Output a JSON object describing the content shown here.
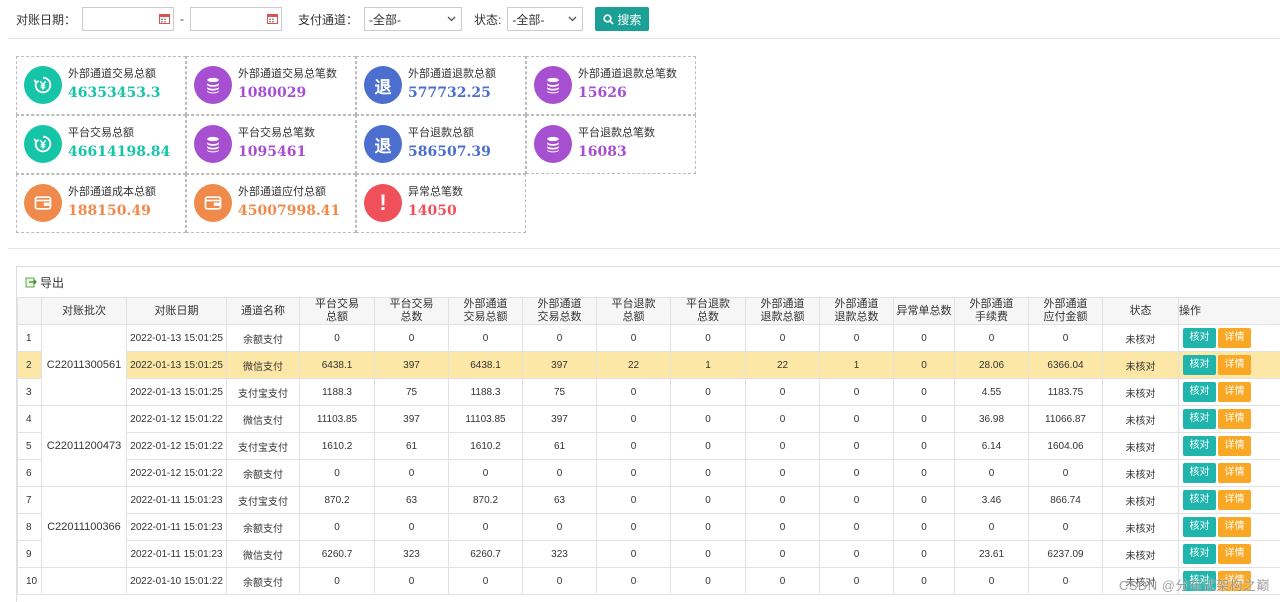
{
  "filters": {
    "date_label": "对账日期：",
    "date_sep": "-",
    "channel_label": "支付通道：",
    "channel_value": "-全部-",
    "status_label": "状态:",
    "status_value": "-全部-",
    "search_label": "搜索"
  },
  "colors": {
    "teal": "#16c4a8",
    "purple": "#a74fd1",
    "blue": "#4c6fcf",
    "orange": "#f08a4b",
    "red": "#f0505a",
    "search_button": "#1aa094",
    "row_highlight": "#fde7a6"
  },
  "stats": [
    {
      "label": "外部通道交易总额",
      "value": "46353453.3",
      "color": "#16c4a8",
      "icon": "refresh-yen-icon",
      "glyph": ""
    },
    {
      "label": "外部通道交易总笔数",
      "value": "1080029",
      "color": "#a74fd1",
      "icon": "coin-stack-icon",
      "glyph": ""
    },
    {
      "label": "外部通道退款总额",
      "value": "577732.25",
      "color": "#4c6fcf",
      "icon": "refund-icon",
      "glyph": "退"
    },
    {
      "label": "外部通道退款总笔数",
      "value": "15626",
      "color": "#a74fd1",
      "icon": "coin-stack-icon",
      "glyph": ""
    },
    {
      "label": "平台交易总额",
      "value": "46614198.84",
      "color": "#16c4a8",
      "icon": "refresh-yen-icon",
      "glyph": ""
    },
    {
      "label": "平台交易总笔数",
      "value": "1095461",
      "color": "#a74fd1",
      "icon": "coin-stack-icon",
      "glyph": ""
    },
    {
      "label": "平台退款总额",
      "value": "586507.39",
      "color": "#4c6fcf",
      "icon": "refund-icon",
      "glyph": "退"
    },
    {
      "label": "平台退款总笔数",
      "value": "16083",
      "color": "#a74fd1",
      "icon": "coin-stack-icon",
      "glyph": ""
    },
    {
      "label": "外部通道成本总额",
      "value": "188150.49",
      "color": "#f08a4b",
      "icon": "wallet-icon",
      "glyph": ""
    },
    {
      "label": "外部通道应付总额",
      "value": "45007998.41",
      "color": "#f08a4b",
      "icon": "wallet-icon",
      "glyph": ""
    },
    {
      "label": "异常总笔数",
      "value": "14050",
      "color": "#f0505a",
      "icon": "exclamation-icon",
      "glyph": "!"
    }
  ],
  "table": {
    "export_label": "导出",
    "columns": [
      "",
      "对账批次",
      "对账日期",
      "通道名称",
      "平台交易\n总额",
      "平台交易\n总数",
      "外部通道\n交易总额",
      "外部通道\n交易总数",
      "平台退款\n总额",
      "平台退款\n总数",
      "外部通道\n退款总额",
      "外部通道\n退款总数",
      "异常单总数",
      "外部通道\n手续费",
      "外部通道\n应付金额",
      "状态",
      "操作"
    ],
    "batches": [
      "C22011300561",
      "C22011200473",
      "C22011100366"
    ],
    "rows": [
      {
        "idx": "1",
        "date": "2022-01-13 15:01:25",
        "channel": "余额支付",
        "vals": [
          "0",
          "0",
          "0",
          "0",
          "0",
          "0",
          "0",
          "0",
          "0",
          "0",
          "0"
        ],
        "status": "未核对"
      },
      {
        "idx": "2",
        "date": "2022-01-13 15:01:25",
        "channel": "微信支付",
        "vals": [
          "6438.1",
          "397",
          "6438.1",
          "397",
          "22",
          "1",
          "22",
          "1",
          "0",
          "28.06",
          "6366.04"
        ],
        "status": "未核对"
      },
      {
        "idx": "3",
        "date": "2022-01-13 15:01:25",
        "channel": "支付宝支付",
        "vals": [
          "1188.3",
          "75",
          "1188.3",
          "75",
          "0",
          "0",
          "0",
          "0",
          "0",
          "4.55",
          "1183.75"
        ],
        "status": "未核对"
      },
      {
        "idx": "4",
        "date": "2022-01-12 15:01:22",
        "channel": "微信支付",
        "vals": [
          "11103.85",
          "397",
          "11103.85",
          "397",
          "0",
          "0",
          "0",
          "0",
          "0",
          "36.98",
          "11066.87"
        ],
        "status": "未核对"
      },
      {
        "idx": "5",
        "date": "2022-01-12 15:01:22",
        "channel": "支付宝支付",
        "vals": [
          "1610.2",
          "61",
          "1610.2",
          "61",
          "0",
          "0",
          "0",
          "0",
          "0",
          "6.14",
          "1604.06"
        ],
        "status": "未核对"
      },
      {
        "idx": "6",
        "date": "2022-01-12 15:01:22",
        "channel": "余额支付",
        "vals": [
          "0",
          "0",
          "0",
          "0",
          "0",
          "0",
          "0",
          "0",
          "0",
          "0",
          "0"
        ],
        "status": "未核对"
      },
      {
        "idx": "7",
        "date": "2022-01-11 15:01:23",
        "channel": "支付宝支付",
        "vals": [
          "870.2",
          "63",
          "870.2",
          "63",
          "0",
          "0",
          "0",
          "0",
          "0",
          "3.46",
          "866.74"
        ],
        "status": "未核对"
      },
      {
        "idx": "8",
        "date": "2022-01-11 15:01:23",
        "channel": "余额支付",
        "vals": [
          "0",
          "0",
          "0",
          "0",
          "0",
          "0",
          "0",
          "0",
          "0",
          "0",
          "0"
        ],
        "status": "未核对"
      },
      {
        "idx": "9",
        "date": "2022-01-11 15:01:23",
        "channel": "微信支付",
        "vals": [
          "6260.7",
          "323",
          "6260.7",
          "323",
          "0",
          "0",
          "0",
          "0",
          "0",
          "23.61",
          "6237.09"
        ],
        "status": "未核对"
      },
      {
        "idx": "10",
        "date": "2022-01-10 15:01:22",
        "channel": "余额支付",
        "vals": [
          "0",
          "0",
          "0",
          "0",
          "0",
          "0",
          "0",
          "0",
          "0",
          "0",
          "0"
        ],
        "status": "未核对"
      }
    ],
    "check_label": "核对",
    "detail_label": "详情"
  },
  "watermark": "CSDN @分布式架构之巅"
}
